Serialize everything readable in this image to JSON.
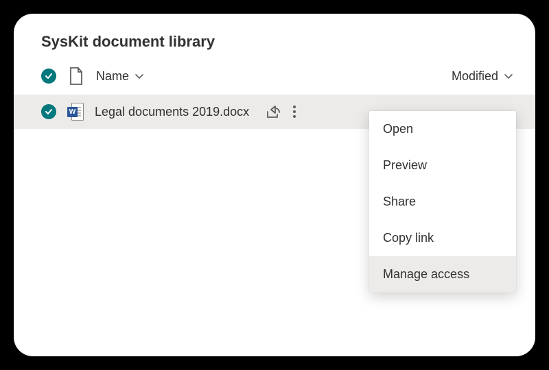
{
  "library": {
    "title": "SysKit document library"
  },
  "columns": {
    "name": "Name",
    "modified": "Modified"
  },
  "item": {
    "name": "Legal documents 2019.docx",
    "selected": true
  },
  "menu": {
    "items": [
      {
        "label": "Open"
      },
      {
        "label": "Preview"
      },
      {
        "label": "Share"
      },
      {
        "label": "Copy link"
      },
      {
        "label": "Manage access"
      }
    ],
    "hovered_index": 4
  },
  "colors": {
    "accent": "#03787c",
    "word_brand": "#2b579a",
    "row_selected_bg": "#edebe9"
  }
}
